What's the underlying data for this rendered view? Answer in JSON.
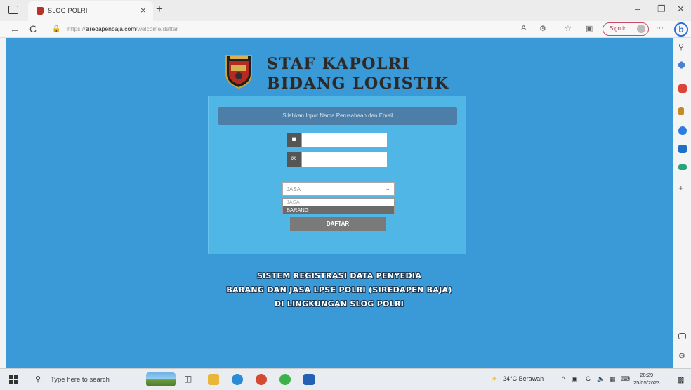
{
  "browser": {
    "tab_title": "SLOG POLRI",
    "tab_close": "×",
    "new_tab": "+",
    "url_prefix": "https://",
    "url_host": "siredapenbaja.com",
    "url_path": "/welcome/daftar",
    "signin_label": "Sign in",
    "bing_label": "b",
    "win_min": "–",
    "win_restore": "❐",
    "win_close": "✕",
    "back": "←",
    "reload": "C",
    "more": "···"
  },
  "header": {
    "title_line1": "STAF KAPOLRI",
    "title_line2": "BIDANG LOGISTIK"
  },
  "form": {
    "heading": "Silahkan Input Nama Perusahaan dan Email",
    "name_value": "",
    "email_value": "",
    "select_value": "JASA",
    "select_caret": "⌄",
    "options": [
      "JASA",
      "BARANG"
    ],
    "highlighted_option": "BARANG",
    "submit_label": "DAFTAR",
    "user_icon": "user-icon",
    "mail_icon": "mail-icon"
  },
  "footer": {
    "line1": "SISTEM REGISTRASI DATA PENYEDIA",
    "line2": "BARANG DAN JASA LPSE POLRI (SIREDAPEN BAJA)",
    "line3": "DI LINGKUNGAN SLOG POLRI"
  },
  "taskbar": {
    "search_placeholder": "Type here to search",
    "weather": "24°C  Berawan",
    "time": "20:29",
    "date": "25/05/2023",
    "tray_caret": "^"
  },
  "colors": {
    "page_bg": "#3a9ad8",
    "panel_bg": "#4fb6e6",
    "panel_head": "#4c7ea8",
    "button": "#7a7a7a",
    "signin_accent": "#b23a52"
  }
}
